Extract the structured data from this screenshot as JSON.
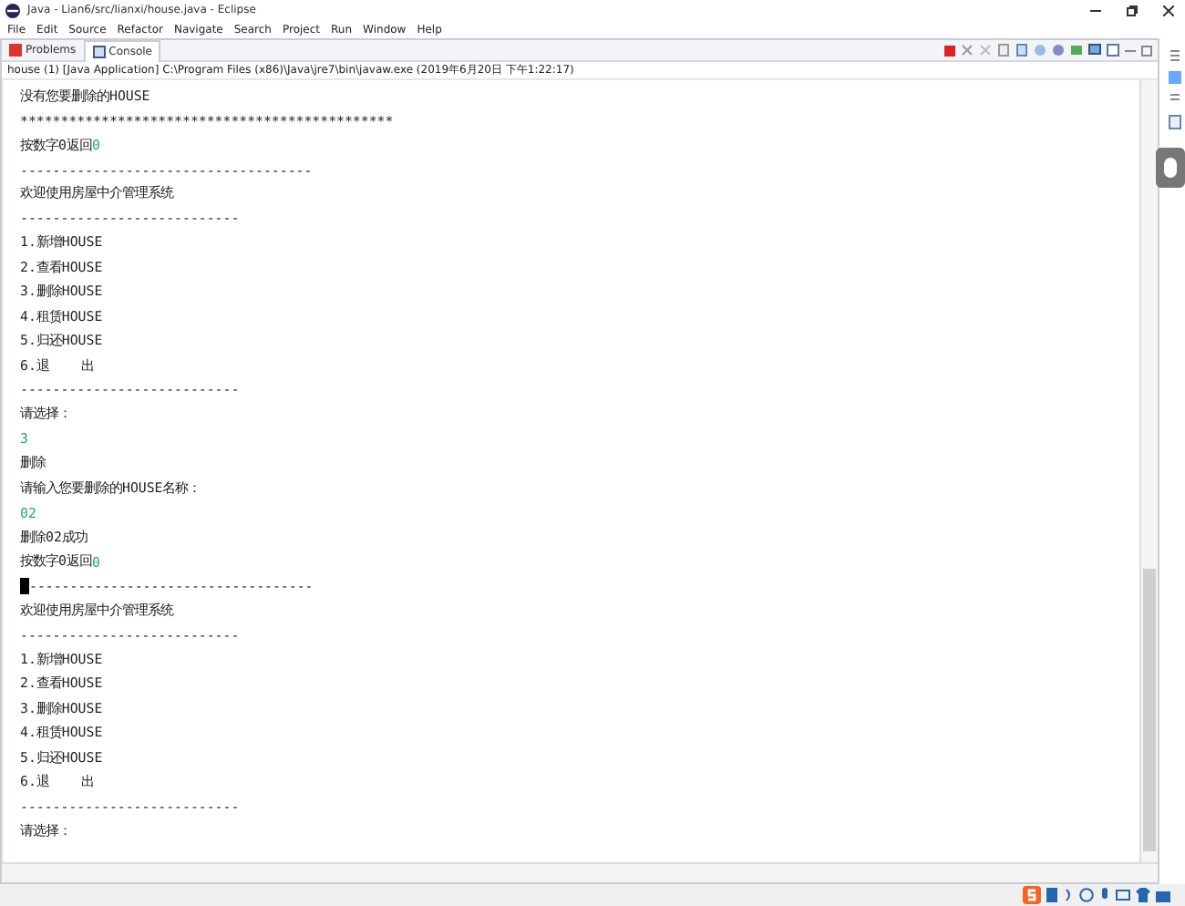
{
  "window": {
    "title": "Java - Lian6/src/lianxi/house.java - Eclipse"
  },
  "menu": [
    "File",
    "Edit",
    "Source",
    "Refactor",
    "Navigate",
    "Search",
    "Project",
    "Run",
    "Window",
    "Help"
  ],
  "tabs": [
    {
      "label": "Problems",
      "selected": false
    },
    {
      "label": "Console",
      "selected": true
    }
  ],
  "console": {
    "header": "house (1) [Java Application] C:\\Program Files (x86)\\Java\\jre7\\bin\\javaw.exe (2019年6月20日 下午1:22:17)",
    "lines": [
      [
        {
          "text": "没有您要删除的HOUSE",
          "input": false
        }
      ],
      [
        {
          "text": "**********************************************",
          "input": false
        }
      ],
      [
        {
          "text": "按数字0返回",
          "input": false
        },
        {
          "text": "0",
          "input": true
        }
      ],
      [
        {
          "text": "------------------------------------",
          "input": false
        }
      ],
      [
        {
          "text": "欢迎使用房屋中介管理系统",
          "input": false
        }
      ],
      [
        {
          "text": "---------------------------",
          "input": false
        }
      ],
      [
        {
          "text": "1.新增HOUSE",
          "input": false
        }
      ],
      [
        {
          "text": "2.查看HOUSE",
          "input": false
        }
      ],
      [
        {
          "text": "3.删除HOUSE",
          "input": false
        }
      ],
      [
        {
          "text": "4.租赁HOUSE",
          "input": false
        }
      ],
      [
        {
          "text": "5.归还HOUSE",
          "input": false
        }
      ],
      [
        {
          "text": "6.退    出",
          "input": false
        }
      ],
      [
        {
          "text": "---------------------------",
          "input": false
        }
      ],
      [
        {
          "text": "请选择：",
          "input": false
        }
      ],
      [
        {
          "text": "3",
          "input": true
        }
      ],
      [
        {
          "text": "删除",
          "input": false
        }
      ],
      [
        {
          "text": "请输入您要删除的HOUSE名称：",
          "input": false
        }
      ],
      [
        {
          "text": "02",
          "input": true
        }
      ],
      [
        {
          "text": "删除02成功",
          "input": false
        }
      ],
      [
        {
          "text": "按数字0返回",
          "input": false
        },
        {
          "text": "0",
          "input": true
        }
      ],
      [
        {
          "text": "-----------------------------------",
          "input": false,
          "cursor": true
        }
      ],
      [
        {
          "text": "欢迎使用房屋中介管理系统",
          "input": false
        }
      ],
      [
        {
          "text": "---------------------------",
          "input": false
        }
      ],
      [
        {
          "text": "1.新增HOUSE",
          "input": false
        }
      ],
      [
        {
          "text": "2.查看HOUSE",
          "input": false
        }
      ],
      [
        {
          "text": "3.删除HOUSE",
          "input": false
        }
      ],
      [
        {
          "text": "4.租赁HOUSE",
          "input": false
        }
      ],
      [
        {
          "text": "5.归还HOUSE",
          "input": false
        }
      ],
      [
        {
          "text": "6.退    出",
          "input": false
        }
      ],
      [
        {
          "text": "---------------------------",
          "input": false
        }
      ],
      [
        {
          "text": "请选择：",
          "input": false
        }
      ]
    ]
  }
}
